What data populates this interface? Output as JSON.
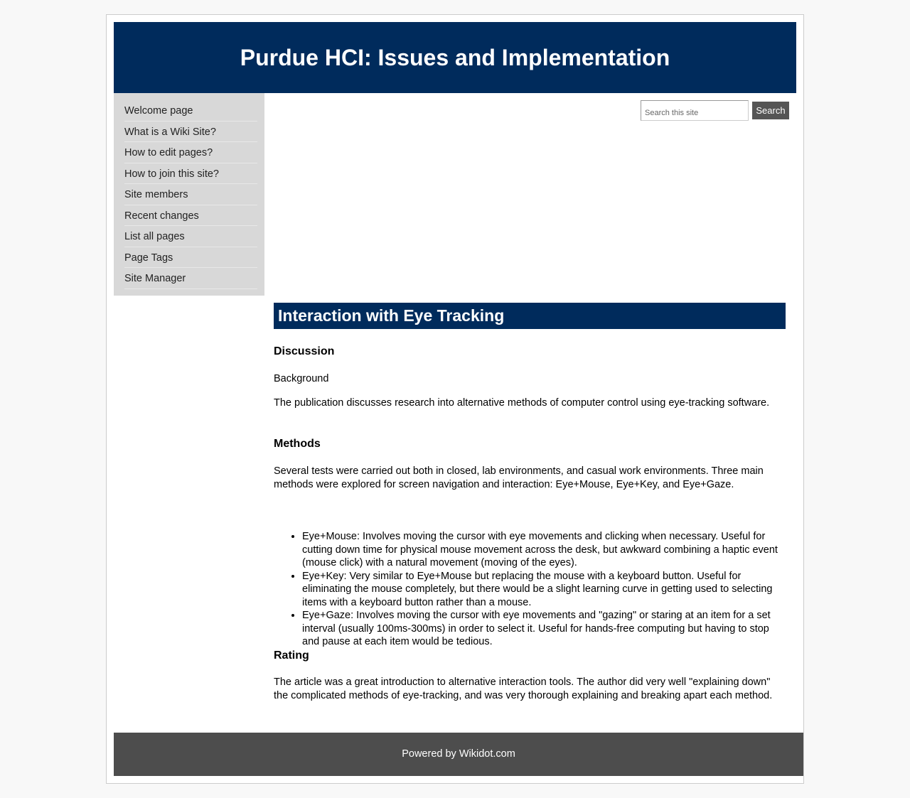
{
  "header": {
    "site_title": "Purdue HCI: Issues and Implementation"
  },
  "sidebar": {
    "items": [
      {
        "label": "Welcome page"
      },
      {
        "label": "What is a Wiki Site?"
      },
      {
        "label": "How to edit pages?"
      },
      {
        "label": "How to join this site?"
      },
      {
        "label": "Site members"
      },
      {
        "label": "Recent changes"
      },
      {
        "label": "List all pages"
      },
      {
        "label": "Page Tags"
      },
      {
        "label": "Site Manager"
      }
    ]
  },
  "search": {
    "placeholder": "Search this site",
    "button_label": "Search"
  },
  "main": {
    "page_title": "Interaction with Eye Tracking",
    "discussion_heading": "Discussion",
    "background_heading": "Background",
    "background_text": "The publication discusses research into alternative methods of computer control using eye-tracking software.",
    "methods_heading": "Methods",
    "methods_text": "Several tests were carried out both in closed, lab environments, and casual work environments. Three main methods were explored for screen navigation and interaction: Eye+Mouse, Eye+Key, and Eye+Gaze.",
    "methods_list": [
      "Eye+Mouse: Involves moving the cursor with eye movements and clicking when necessary. Useful for cutting down time for physical mouse movement across the desk, but awkward combining a haptic event (mouse click) with a natural movement (moving of the eyes).",
      "Eye+Key: Very similar to Eye+Mouse but replacing the mouse with a keyboard button. Useful for eliminating the mouse completely, but there would be a slight learning curve in getting used to selecting items with a keyboard button rather than a mouse.",
      "Eye+Gaze: Involves moving the cursor with eye movements and \"gazing\" or staring at an item for a set interval (usually 100ms-300ms) in order to select it. Useful for hands-free computing but having to stop and pause at each item would be tedious."
    ],
    "rating_heading": "Rating",
    "rating_text": "The article was a great introduction to alternative interaction tools. The author did very well \"explaining down\" the complicated methods of eye-tracking, and was very thorough explaining and breaking apart each method."
  },
  "footer": {
    "powered_by": "Powered by Wikidot.com"
  },
  "colors": {
    "header_bg": "#002b5c",
    "sidebar_bg": "#d8d8d8",
    "footer_bg": "#4d4d4d",
    "search_button_bg": "#555555"
  }
}
